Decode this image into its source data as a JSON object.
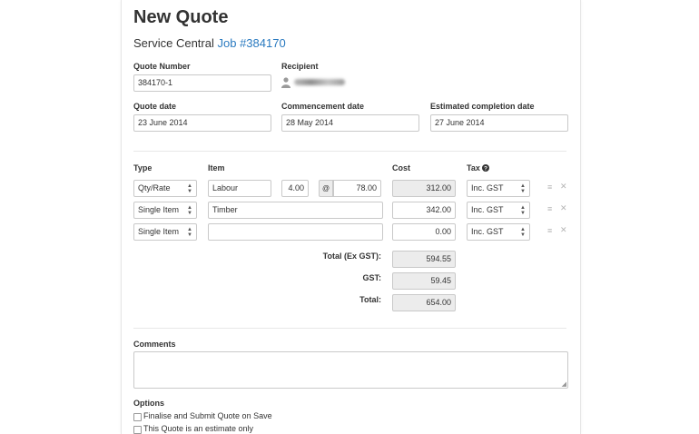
{
  "header": {
    "title": "New Quote",
    "subtitle_prefix": "Service Central",
    "job_link": "Job #384170"
  },
  "fields": {
    "quote_number_label": "Quote Number",
    "quote_number_value": "384170-1",
    "recipient_label": "Recipient",
    "quote_date_label": "Quote date",
    "quote_date_value": "23 June 2014",
    "commencement_label": "Commencement date",
    "commencement_value": "28 May 2014",
    "completion_label": "Estimated completion date",
    "completion_value": "27 June 2014"
  },
  "items_table": {
    "headers": {
      "type": "Type",
      "item": "Item",
      "cost": "Cost",
      "tax": "Tax"
    },
    "at_symbol": "@",
    "rows": [
      {
        "type": "Qty/Rate",
        "item": "Labour",
        "qty": "4.00",
        "rate": "78.00",
        "cost": "312.00",
        "tax": "Inc. GST"
      },
      {
        "type": "Single Item",
        "item": "Timber",
        "cost": "342.00",
        "tax": "Inc. GST"
      },
      {
        "type": "Single Item",
        "item": "",
        "cost": "0.00",
        "tax": "Inc. GST"
      }
    ]
  },
  "totals": {
    "ex_gst_label": "Total (Ex GST):",
    "ex_gst_value": "594.55",
    "gst_label": "GST:",
    "gst_value": "59.45",
    "total_label": "Total:",
    "total_value": "654.00"
  },
  "comments": {
    "label": "Comments",
    "value": ""
  },
  "options": {
    "label": "Options",
    "items": [
      {
        "label": "Finalise and Submit Quote on Save",
        "checked": false
      },
      {
        "label": "This Quote is an estimate only",
        "checked": false
      }
    ]
  },
  "colors": {
    "link": "#2a7ac0",
    "readonly_bg": "#ececec",
    "border": "#c9c9c9"
  },
  "icons": [
    "user-icon",
    "help-icon",
    "drag-handle-icon",
    "remove-icon",
    "select-arrows-icon",
    "resize-handle-icon"
  ]
}
